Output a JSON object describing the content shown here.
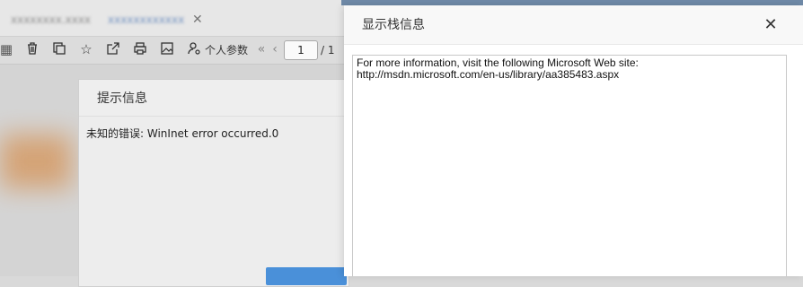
{
  "app": {
    "tabs": [
      {
        "label": "xxxxxxxx.xxxx"
      },
      {
        "label": "xxxxxxxxxxxx"
      }
    ],
    "toolbar": {
      "icons": [
        "grid-icon",
        "trash-icon",
        "copy-icon",
        "star-icon",
        "external-link-icon",
        "print-icon",
        "image-icon",
        "user-settings-icon"
      ],
      "personal_params_label": "个人参数",
      "page_current": "1",
      "page_total": "/ 1"
    }
  },
  "prompt_dialog": {
    "title": "提示信息",
    "message": "未知的错误: WinInet error occurred.0"
  },
  "stack_dialog": {
    "title": "显示栈信息",
    "close_glyph": "✕",
    "lines": [
      "For more information, visit the following Microsoft Web site:",
      "http://msdn.microsoft.com/en-us/library/aa385483.aspx"
    ]
  }
}
